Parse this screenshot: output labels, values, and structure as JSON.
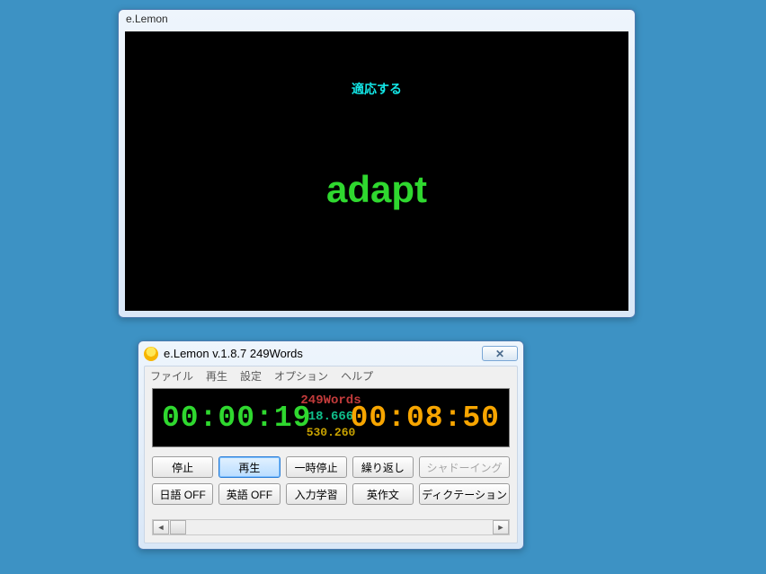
{
  "display_window": {
    "title": "e.Lemon",
    "jp_text": "適応する",
    "en_text": "adapt"
  },
  "control_window": {
    "title": "e.Lemon v.1.8.7  249Words",
    "close_glyph": "✕",
    "menu": {
      "file": "ファイル",
      "play": "再生",
      "settings": "設定",
      "options": "オプション",
      "help": "ヘルプ"
    },
    "meter": {
      "left_time": "00:00:19",
      "right_time": "00:08:50",
      "center_top": "249Words",
      "center_mid": "18.666",
      "center_bot": "530.260"
    },
    "buttons": {
      "stop": "停止",
      "play": "再生",
      "pause": "一時停止",
      "repeat": "繰り返し",
      "shadowing": "シャドーイング",
      "jp_off": "日語 OFF",
      "en_off": "英語 OFF",
      "input_study": "入力学習",
      "composition": "英作文",
      "dictation": "ディクテーション"
    },
    "scroll": {
      "left": "◄",
      "right": "►"
    }
  }
}
